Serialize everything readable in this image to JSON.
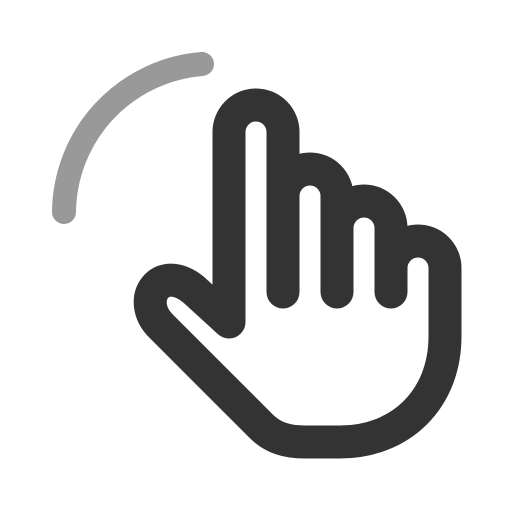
{
  "icon": {
    "name": "tap-gesture-icon",
    "parts": [
      "hand-pointer-icon",
      "touch-arc-icon"
    ]
  },
  "colors": {
    "background": "#ffffff",
    "hand_stroke": "#333333",
    "arc_stroke": "#999999"
  }
}
